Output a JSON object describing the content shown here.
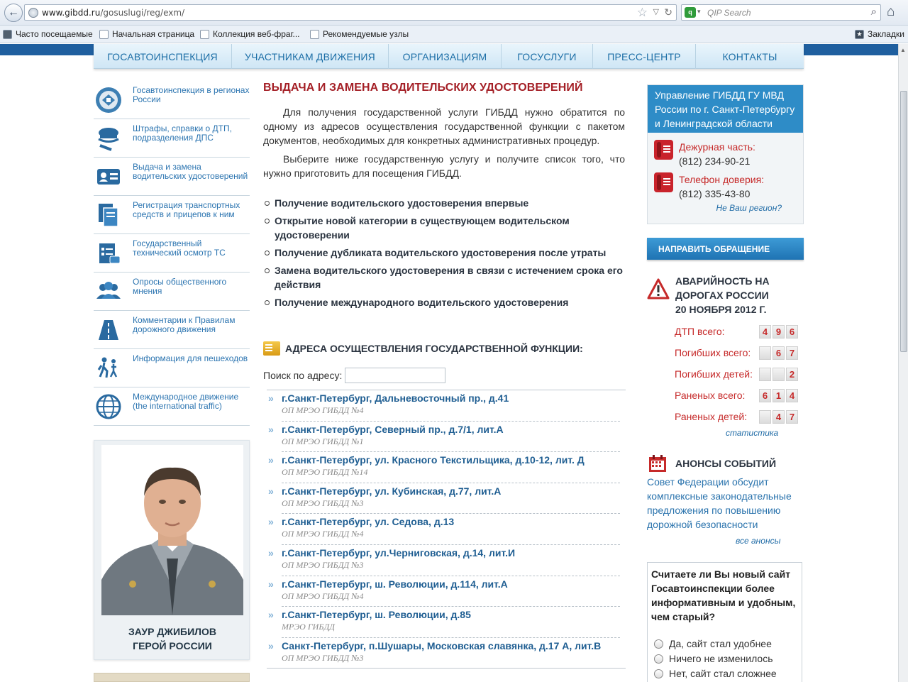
{
  "browser": {
    "url_host": "www.gibdd.ru",
    "url_path": "/gosuslugi/reg/exm/",
    "search_placeholder": "QIP Search",
    "bookmarks": [
      "Часто посещаемые",
      "Начальная страница",
      "Коллекция веб-фраг...",
      "Рекомендуемые узлы"
    ],
    "bookmarks_menu": "Закладки"
  },
  "nav": [
    "ГОСАВТОИНСПЕКЦИЯ",
    "УЧАСТНИКАМ ДВИЖЕНИЯ",
    "ОРГАНИЗАЦИЯМ",
    "ГОСУСЛУГИ",
    "ПРЕСС-ЦЕНТР",
    "КОНТАКТЫ"
  ],
  "sidebar": {
    "items": [
      {
        "label": "Госавтоинспекция в регионах России",
        "icon": "emblem-icon"
      },
      {
        "label": "Штрафы, справки о ДТП, подразделения ДПС",
        "icon": "police-cap-icon"
      },
      {
        "label": "Выдача и замена водительских удостоверений",
        "icon": "id-card-icon"
      },
      {
        "label": "Регистрация транспортных средств и прицепов к ним",
        "icon": "documents-icon"
      },
      {
        "label": "Государственный технический осмотр ТС",
        "icon": "inspection-checklist-icon"
      },
      {
        "label": "Опросы общественного мнения",
        "icon": "people-icon"
      },
      {
        "label": "Комментарии к Правилам дорожного движения",
        "icon": "road-icon"
      },
      {
        "label": "Информация для пешеходов",
        "icon": "pedestrians-icon"
      },
      {
        "label": "Международное движение (the international traffic)",
        "icon": "globe-icon"
      }
    ],
    "hero": {
      "name_line1": "ЗАУР ДЖИБИЛОВ",
      "name_line2": "ГЕРОЙ РОССИИ"
    }
  },
  "main": {
    "title": "ВЫДАЧА И ЗАМЕНА ВОДИТЕЛЬСКИХ УДОСТОВЕРЕНИЙ",
    "intro1": "Для получения государственной услуги ГИБДД нужно обратится по одному из адресов осуществления государственной функции с пакетом документов, необходимых для конкретных административных процедур.",
    "intro2": "Выберите ниже государственную услугу и получите список того, что нужно приготовить для посещения ГИБДД.",
    "services": [
      "Получение водительского удостоверения впервые",
      "Открытие новой категории в существующем водительском удостоверении",
      "Получение дубликата водительского удостоверения после утраты",
      "Замена водительского удостоверения в связи с истечением срока его действия",
      "Получение международного водительского удостоверения"
    ],
    "addresses_title": "АДРЕСА ОСУЩЕСТВЛЕНИЯ ГОСУДАРСТВЕННОЙ ФУНКЦИИ:",
    "search_label": "Поиск по адресу:",
    "search_value": "",
    "addresses": [
      {
        "address": "г.Санкт-Петербург, Дальневосточный пр., д.41",
        "office": "ОП МРЭО ГИБДД №4"
      },
      {
        "address": "г.Санкт-Петербург, Северный пр., д.7/1, лит.А",
        "office": "ОП МРЭО ГИБДД №1"
      },
      {
        "address": "г.Санкт-Петербург, ул. Красного Текстильщика, д.10-12, лит. Д",
        "office": "ОП МРЭО ГИБДД №14"
      },
      {
        "address": "г.Санкт-Петербург, ул. Кубинская, д.77, лит.А",
        "office": "ОП МРЭО ГИБДД №3"
      },
      {
        "address": "г.Санкт-Петербург, ул. Седова, д.13",
        "office": "ОП МРЭО ГИБДД №4"
      },
      {
        "address": "г.Санкт-Петербург, ул.Черниговская, д.14, лит.И",
        "office": "ОП МРЭО ГИБДД №3"
      },
      {
        "address": "г.Санкт-Петербург, ш. Революции, д.114, лит.А",
        "office": "ОП МРЭО ГИБДД №4"
      },
      {
        "address": "г.Санкт-Петербург, ш. Революции, д.85",
        "office": "МРЭО ГИБДД"
      },
      {
        "address": "Санкт-Петербург, п.Шушары, Московская славянка, д.17 А, лит.В",
        "office": "ОП МРЭО ГИБДД №3"
      }
    ]
  },
  "right": {
    "contact_title": "Управление ГИБДД ГУ МВД России по г. Санкт-Петербургу и Ленинградской области",
    "duty_label": "Дежурная часть:",
    "duty_phone": "(812) 234-90-21",
    "trust_label": "Телефон доверия:",
    "trust_phone": "(812) 335-43-80",
    "not_region": "Не Ваш регион?",
    "appeal_button": "НАПРАВИТЬ ОБРАЩЕНИЕ",
    "accidents_title_1": "АВАРИЙНОСТЬ НА",
    "accidents_title_2": "ДОРОГАХ РОССИИ",
    "accidents_title_3": "20 НОЯБРЯ 2012 Г.",
    "accidents": [
      {
        "label": "ДТП всего:",
        "digits": [
          "4",
          "9",
          "6"
        ]
      },
      {
        "label": "Погибших всего:",
        "digits": [
          "",
          "6",
          "7"
        ]
      },
      {
        "label": "Погибших детей:",
        "digits": [
          "",
          "",
          "2"
        ]
      },
      {
        "label": "Раненых всего:",
        "digits": [
          "6",
          "1",
          "4"
        ]
      },
      {
        "label": "Раненых детей:",
        "digits": [
          "",
          "4",
          "7"
        ]
      }
    ],
    "stats_link": "статистика",
    "events_title": "АНОНСЫ СОБЫТИЙ",
    "events_text": "Совет Федерации обсудит комплексные законодательные предложения по повышению дорожной безопасности",
    "events_link": "все анонсы",
    "poll_question": "Считаете ли Вы новый сайт Госавтоинспекции более информативным и удобным, чем старый?",
    "poll_options": [
      "Да, сайт стал удобнее",
      "Ничего не изменилось",
      "Нет, сайт стал сложнее"
    ]
  },
  "colors": {
    "brand_blue": "#2e8cc7",
    "title_red": "#a41f26",
    "link_blue": "#1f5e92"
  }
}
